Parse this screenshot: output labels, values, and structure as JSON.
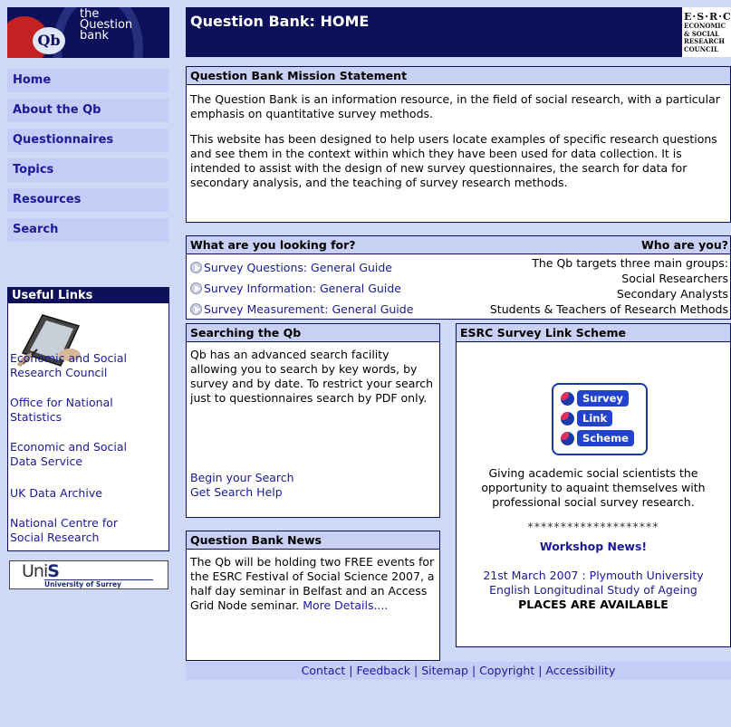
{
  "logo": {
    "text_line1": "the",
    "text_line2": "Question",
    "text_line3": "bank",
    "badge": "Qb"
  },
  "header": {
    "title": "Question Bank: HOME",
    "esrc_top": "E·S·R·C",
    "esrc_l1": "ECONOMIC",
    "esrc_l2": "& SOCIAL",
    "esrc_l3": "RESEARCH",
    "esrc_l4": "COUNCIL"
  },
  "nav": [
    "Home",
    "About the Qb",
    "Questionnaires",
    "Topics",
    "Resources",
    "Search"
  ],
  "useful_links": {
    "title": "Useful Links",
    "links": [
      [
        "Economic and Social",
        "Research Council"
      ],
      [
        "Office for National",
        "Statistics"
      ],
      [
        "Economic and Social",
        "Data Service"
      ],
      [
        "UK Data Archive"
      ],
      [
        "National Centre for",
        "Social Research"
      ]
    ]
  },
  "unis": {
    "mark_a": "Uni",
    "mark_b": "S",
    "sub": "University of Surrey"
  },
  "mission": {
    "title": "Question Bank Mission Statement",
    "p1": "The Question Bank is an information resource, in the field of social research, with a particular emphasis on quantitative survey methods.",
    "p2": "This website has been designed to help users locate examples of specific research questions and see them in the context within which they have been used for data collection. It is intended to assist with the design of new survey questionnaires, the search for data for secondary analysis, and the teaching of survey research methods."
  },
  "looking": {
    "title": "What are you looking for?",
    "who_title": "Who are you?",
    "guides": [
      "Survey Questions: General Guide",
      "Survey Information: General Guide",
      "Survey Measurement: General Guide"
    ],
    "who": [
      "The Qb targets three main groups:",
      "Social Researchers",
      "Secondary Analysts",
      "Students & Teachers of Research Methods"
    ]
  },
  "searching": {
    "title": "Searching the Qb",
    "body": "Qb has an advanced search facility allowing you to search by key words, by survey and by date. To restrict your search just to questionnaires search by PDF only.",
    "link1": "Begin your Search",
    "link2": "Get Search Help"
  },
  "news": {
    "title": "Question Bank News",
    "body": "The Qb will be holding two FREE events for the ESRC Festival of Social Science 2007, a half day seminar in Belfast and an Access Grid Node seminar.",
    "more": "More Details...."
  },
  "scheme": {
    "title": "ESRC Survey Link Scheme",
    "pills": [
      "Survey",
      "Link",
      "Scheme"
    ],
    "desc": [
      "Giving academic social scientists the",
      "opportunity to aquaint themselves with",
      "professional social survey research."
    ],
    "stars": "********************",
    "workshop": "Workshop News!",
    "event1": "21st March 2007 : Plymouth University",
    "event2": "English Longitudinal Study of Ageing",
    "event3": "PLACES ARE AVAILABLE"
  },
  "footer": [
    "Contact",
    "Feedback",
    "Sitemap",
    "Copyright",
    "Accessibility"
  ],
  "colors": {
    "navy": "#0c0f5a",
    "nav_bg": "#c4cdf5",
    "page_bg": "#cfd8f5",
    "link": "#1a1a99"
  }
}
